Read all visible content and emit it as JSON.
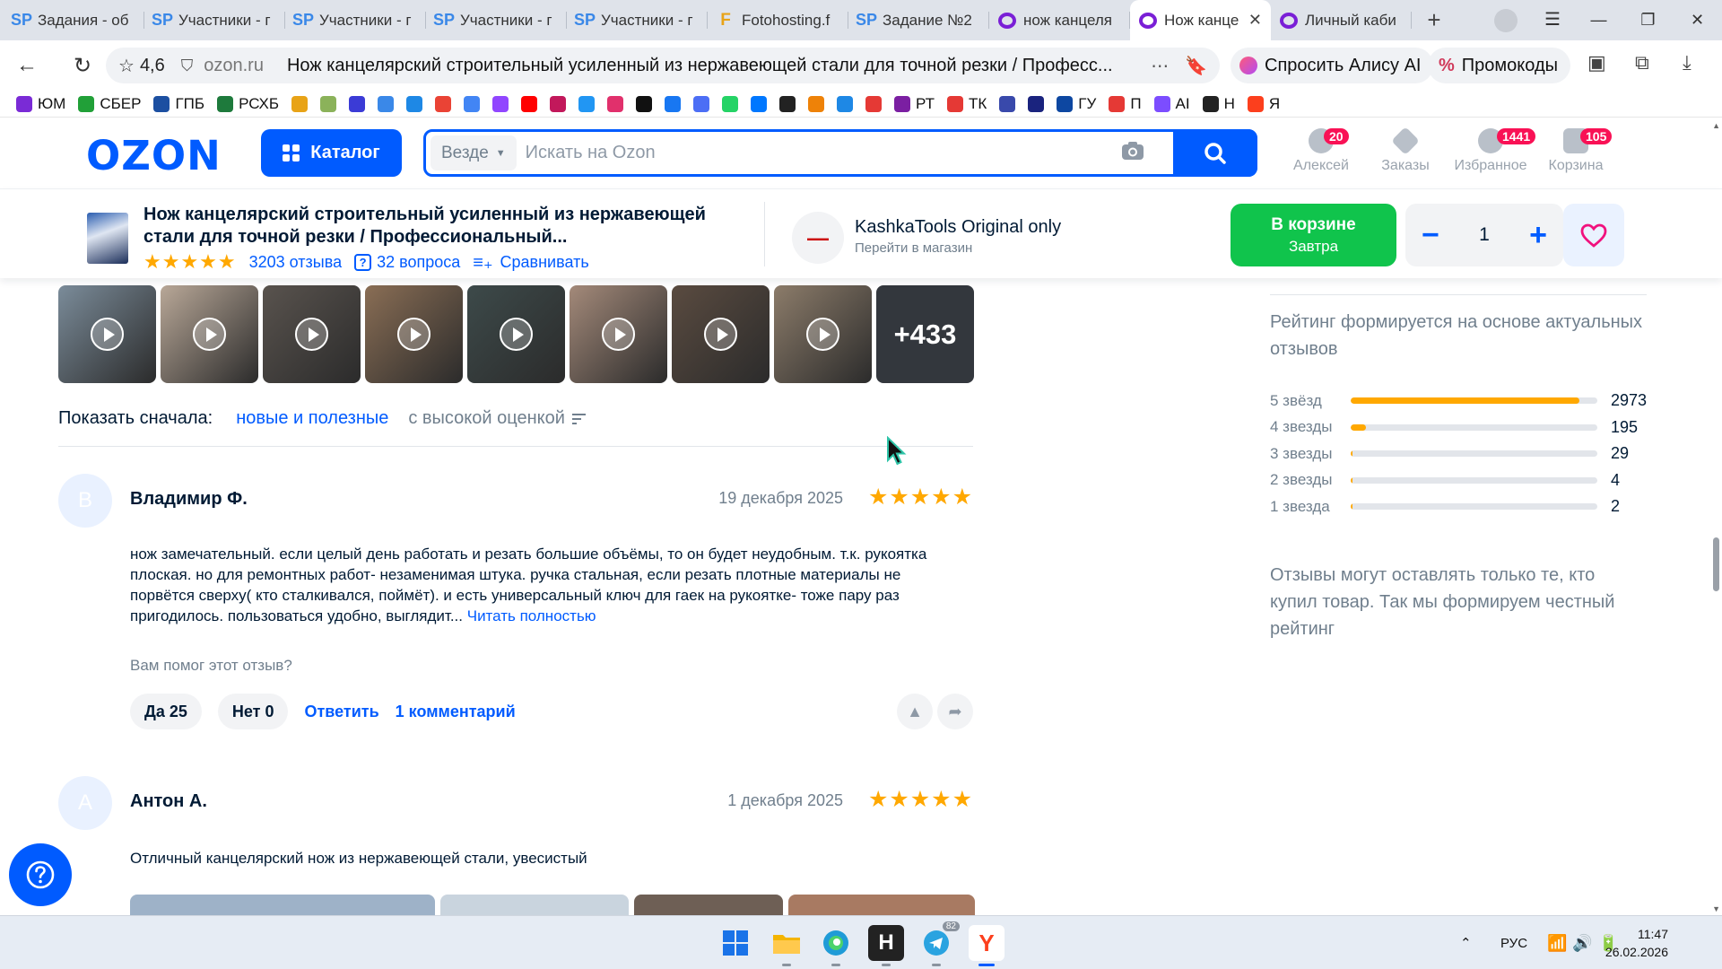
{
  "browser": {
    "tabs": [
      {
        "label": "Задания - об",
        "icon": "sp-icon"
      },
      {
        "label": "Участники - г",
        "icon": "sp-icon"
      },
      {
        "label": "Участники - г",
        "icon": "sp-icon"
      },
      {
        "label": "Участники - г",
        "icon": "sp-icon"
      },
      {
        "label": "Участники - г",
        "icon": "sp-icon"
      },
      {
        "label": "Fotohosting.f",
        "icon": "fotohosting-icon"
      },
      {
        "label": "Задание №2",
        "icon": "sp-icon"
      },
      {
        "label": "нож канцеля",
        "icon": "ozon-tab-icon"
      },
      {
        "label": "Нож канце",
        "icon": "ozon-tab-icon",
        "active": true
      },
      {
        "label": "Личный каби",
        "icon": "ozon-tab-icon"
      }
    ],
    "address": {
      "site_rating": "4,6",
      "domain": "ozon.ru",
      "page_title": "Нож канцелярский строительный усиленный из нержавеющей стали для точной резки / Професс..."
    },
    "alice_label": "Спросить Алису AI",
    "promo_label": "Промокоды",
    "bookmarks": [
      {
        "label": "ЮМ",
        "color": "#7a2bd6"
      },
      {
        "label": "СБЕР",
        "color": "#21a038"
      },
      {
        "label": "ГПБ",
        "color": "#1c4fa1"
      },
      {
        "label": "РСХБ",
        "color": "#1e7a3c"
      },
      {
        "label": "",
        "color": "#e8a317"
      },
      {
        "label": "",
        "color": "#8bb25a"
      },
      {
        "label": "",
        "color": "#3b3bd6"
      },
      {
        "label": "",
        "color": "#3a88e8"
      },
      {
        "label": "",
        "color": "#1e88e5"
      },
      {
        "label": "",
        "color": "#ea4335"
      },
      {
        "label": "",
        "color": "#4285f4"
      },
      {
        "label": "",
        "color": "#9146ff"
      },
      {
        "label": "",
        "color": "#ff0000"
      },
      {
        "label": "",
        "color": "#c2185b"
      },
      {
        "label": "",
        "color": "#2196f3"
      },
      {
        "label": "",
        "color": "#e1306c"
      },
      {
        "label": "",
        "color": "#111111"
      },
      {
        "label": "",
        "color": "#1877f2"
      },
      {
        "label": "",
        "color": "#4c6ef5"
      },
      {
        "label": "",
        "color": "#25d366"
      },
      {
        "label": "",
        "color": "#0077ff"
      },
      {
        "label": "",
        "color": "#222222"
      },
      {
        "label": "",
        "color": "#ee8208"
      },
      {
        "label": "",
        "color": "#1e88e5"
      },
      {
        "label": "",
        "color": "#e53935"
      },
      {
        "label": "РТ",
        "color": "#7b1fa2"
      },
      {
        "label": "ТК",
        "color": "#e53935"
      },
      {
        "label": "",
        "color": "#3949ab"
      },
      {
        "label": "",
        "color": "#1a237e"
      },
      {
        "label": "ГУ",
        "color": "#0d47a1"
      },
      {
        "label": "П",
        "color": "#e53935"
      },
      {
        "label": "AI",
        "color": "#7c4dff"
      },
      {
        "label": "Н",
        "color": "#222222"
      },
      {
        "label": "Я",
        "color": "#fc3f1d"
      }
    ]
  },
  "header": {
    "logo": "OZON",
    "catalog_label": "Каталог",
    "search_scope": "Везде",
    "search_placeholder": "Искать на Ozon",
    "icons": [
      {
        "label": "Алексей",
        "badge": "20"
      },
      {
        "label": "Заказы",
        "badge": ""
      },
      {
        "label": "Избранное",
        "badge": "1441"
      },
      {
        "label": "Корзина",
        "badge": "105"
      }
    ]
  },
  "product": {
    "name": "Нож канцелярский строительный усиленный из нержавеющей стали для точной резки / Профессиональный...",
    "stars": "★★★★★",
    "reviews_link": "3203 отзыва",
    "questions_link": "32 вопроса",
    "compare_link": "Сравнивать",
    "seller_name": "KashkaTools Original only",
    "seller_link": "Перейти в магазин",
    "cart_label": "В корзине",
    "cart_sub": "Завтра",
    "quantity": "1"
  },
  "media": {
    "thumbnails": [
      {
        "color": "#7b8c9a"
      },
      {
        "color": "#b9a898"
      },
      {
        "color": "#59534e"
      },
      {
        "color": "#8a6e55"
      },
      {
        "color": "#3d4a4a"
      },
      {
        "color": "#a48a7a"
      },
      {
        "color": "#5a4b40"
      },
      {
        "color": "#8c7c6a"
      }
    ],
    "more_label": "+433"
  },
  "sort": {
    "label": "Показать сначала:",
    "option_a": "новые и полезные",
    "option_b": "с высокой оценкой"
  },
  "reviews": [
    {
      "initial": "В",
      "author": "Владимир Ф.",
      "date": "19 декабря 2025",
      "stars": "★★★★★",
      "text": "нож замечательный. если целый день работать и резать большие объёмы, то он будет неудобным. т.к. рукоятка плоская. но для ремонтных работ- незаменимая штука. ручка стальная, если резать плотные материалы не порвётся сверху( кто сталкивался, поймёт). и есть универсальный ключ для гаек на рукоятке- тоже пару раз пригодилось. пользоваться удобно, выглядит...",
      "read_more": "Читать полностью",
      "helpful_q": "Вам помог этот отзыв?",
      "yes": "Да 25",
      "no": "Нет 0",
      "reply": "Ответить",
      "comments": "1 комментарий"
    },
    {
      "initial": "А",
      "author": "Антон А.",
      "date": "1 декабря 2025",
      "stars": "★★★★★",
      "text": "Отличный канцелярский нож из нержавеющей стали, увесистый"
    }
  ],
  "rating_panel": {
    "note": "Рейтинг формируется на основе актуальных отзывов",
    "rows": [
      {
        "label": "5 звёзд",
        "count": "2973",
        "fraction": 0.928
      },
      {
        "label": "4 звезды",
        "count": "195",
        "fraction": 0.061
      },
      {
        "label": "3 звезды",
        "count": "29",
        "fraction": 0.009
      },
      {
        "label": "2 звезды",
        "count": "4",
        "fraction": 0.0012
      },
      {
        "label": "1 звезда",
        "count": "2",
        "fraction": 0.0006
      }
    ],
    "only_note": "Отзывы могут оставлять только те, кто купил товар. Так мы формируем честный рейтинг"
  },
  "taskbar": {
    "telegram_badge": "82",
    "lang": "РУС",
    "time": "11:47",
    "date": "26.02.2026"
  }
}
